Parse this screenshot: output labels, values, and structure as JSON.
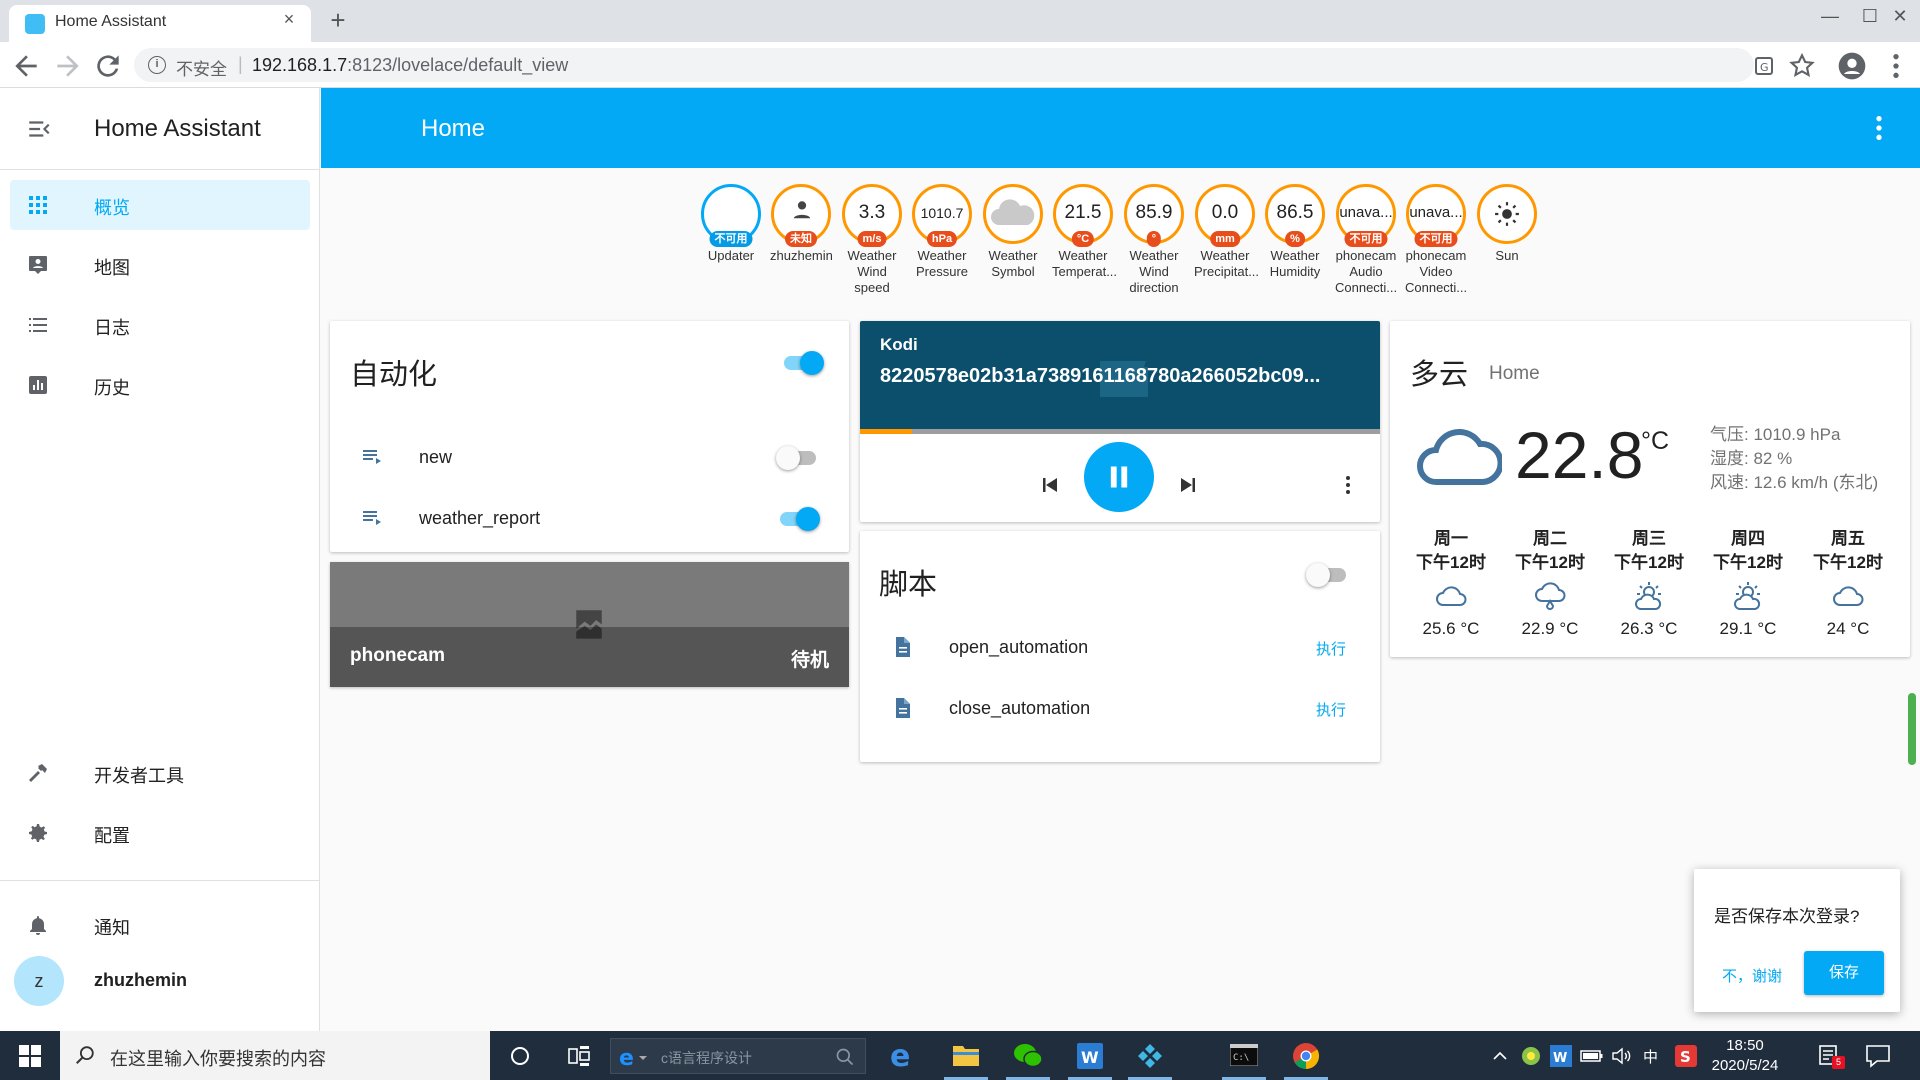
{
  "browser": {
    "tab_title": "Home Assistant",
    "close_glyph": "×",
    "new_tab_glyph": "+",
    "win_min": "—",
    "win_max": "☐",
    "win_close": "✕",
    "insecure_label": "不安全",
    "url_host": "192.168.1.7",
    "url_rest": ":8123/lovelace/default_view"
  },
  "sidebar": {
    "title": "Home Assistant",
    "items": [
      {
        "label": "概览",
        "icon": "grid-icon"
      },
      {
        "label": "地图",
        "icon": "map-account-icon"
      },
      {
        "label": "日志",
        "icon": "list-icon"
      },
      {
        "label": "历史",
        "icon": "chart-icon"
      }
    ],
    "dev_tools": "开发者工具",
    "config": "配置",
    "notifications": "通知",
    "user_initial": "z",
    "user_name": "zhuzhemin"
  },
  "header": {
    "title": "Home"
  },
  "badges": [
    {
      "value": "",
      "unit": "不可用",
      "name": "Updater"
    },
    {
      "value": "",
      "unit": "未知",
      "name": "zhuzhemin"
    },
    {
      "value": "3.3",
      "unit": "m/s",
      "name": "Weather Wind speed"
    },
    {
      "value": "1010.7",
      "unit": "hPa",
      "name": "Weather Pressure"
    },
    {
      "value": "",
      "unit": "",
      "name": "Weather Symbol"
    },
    {
      "value": "21.5",
      "unit": "°C",
      "name": "Weather Temperat..."
    },
    {
      "value": "85.9",
      "unit": "°",
      "name": "Weather Wind direction"
    },
    {
      "value": "0.0",
      "unit": "mm",
      "name": "Weather Precipitat..."
    },
    {
      "value": "86.5",
      "unit": "%",
      "name": "Weather Humidity"
    },
    {
      "value": "unava...",
      "unit": "不可用",
      "name": "phonecam Audio Connecti..."
    },
    {
      "value": "unava...",
      "unit": "不可用",
      "name": "phonecam Video Connecti..."
    },
    {
      "value": "",
      "unit": "",
      "name": "Sun"
    }
  ],
  "automation_card": {
    "title": "自动化",
    "all_on": true,
    "rows": [
      {
        "name": "new",
        "on": false
      },
      {
        "name": "weather_report",
        "on": true
      }
    ]
  },
  "camera_card": {
    "name": "phonecam",
    "state": "待机"
  },
  "media_card": {
    "name": "Kodi",
    "title": "8220578e02b31a7389161168780a266052bc09...",
    "progress": 0.1
  },
  "script_card": {
    "title": "脚本",
    "all_on": false,
    "rows": [
      {
        "name": "open_automation",
        "action": "执行"
      },
      {
        "name": "close_automation",
        "action": "执行"
      }
    ]
  },
  "weather_card": {
    "condition": "多云",
    "location": "Home",
    "temperature": "22.8",
    "temp_unit": "°C",
    "pressure": "气压: 1010.9 hPa",
    "humidity": "湿度: 82 %",
    "wind": "风速: 12.6 km/h (东北)",
    "forecast": [
      {
        "day": "周一",
        "time": "下午12时",
        "temp": "25.6 °C",
        "icon": "cloudy-icon"
      },
      {
        "day": "周二",
        "time": "下午12时",
        "temp": "22.9 °C",
        "icon": "rainy-icon"
      },
      {
        "day": "周三",
        "time": "下午12时",
        "temp": "26.3 °C",
        "icon": "partly-cloudy-icon"
      },
      {
        "day": "周四",
        "time": "下午12时",
        "temp": "29.1 °C",
        "icon": "partly-cloudy-icon"
      },
      {
        "day": "周五",
        "time": "下午12时",
        "temp": "24 °C",
        "icon": "cloudy-icon"
      }
    ]
  },
  "save_dialog": {
    "text": "是否保存本次登录?",
    "no_label": "不，谢谢",
    "save_label": "保存"
  },
  "taskbar": {
    "search_placeholder": "在这里输入你要搜索的内容",
    "mini_search": "c语言程序设计",
    "ime": "中",
    "time": "18:50",
    "date": "2020/5/24",
    "notif_count": "5"
  },
  "colors": {
    "accent": "#03a9f4",
    "badge_border": "#ff9800",
    "badge_label": "#e84d1c",
    "media_bg": "#0b4f6c"
  }
}
